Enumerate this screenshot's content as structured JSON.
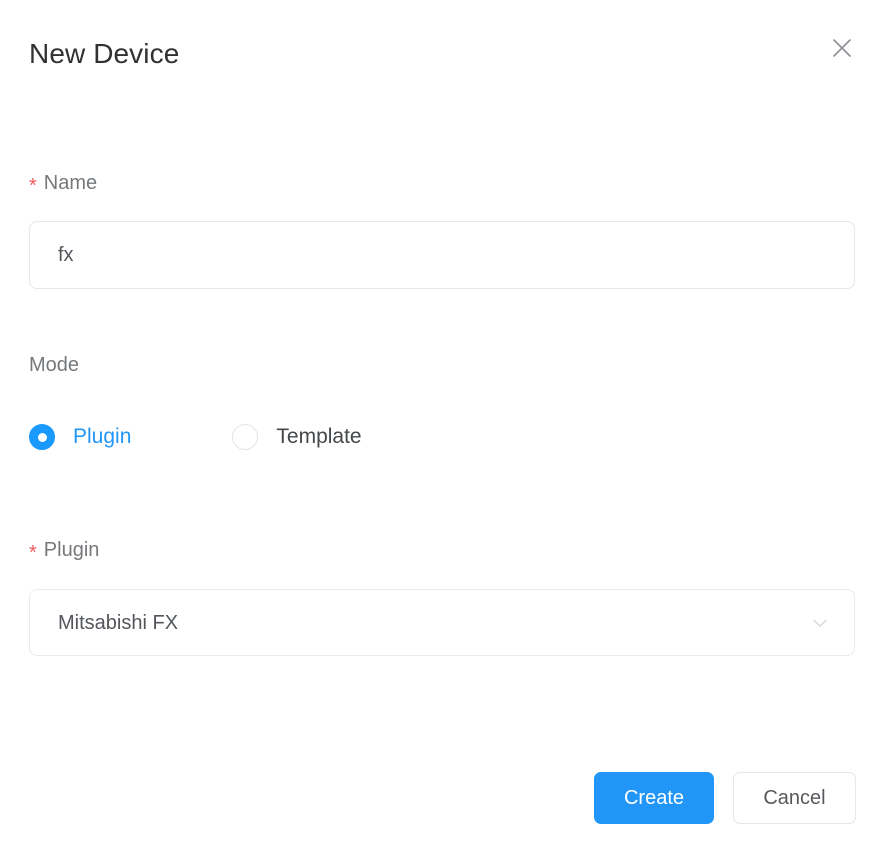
{
  "dialog": {
    "title": "New Device",
    "close_icon": "close-icon"
  },
  "form": {
    "name_field": {
      "label": "Name",
      "required_marker": "*",
      "value": "fx",
      "placeholder": ""
    },
    "mode_field": {
      "label": "Mode",
      "options": [
        {
          "label": "Plugin",
          "selected": true
        },
        {
          "label": "Template",
          "selected": false
        }
      ]
    },
    "plugin_field": {
      "label": "Plugin",
      "required_marker": "*",
      "value": "Mitsabishi FX",
      "arrow_icon": "chevron-down-icon"
    }
  },
  "footer": {
    "create_label": "Create",
    "cancel_label": "Cancel"
  },
  "colors": {
    "accent": "#2196f8",
    "required": "#f05a5a",
    "border": "#e4e7ea",
    "text": "#53565a",
    "label": "#76797c"
  }
}
